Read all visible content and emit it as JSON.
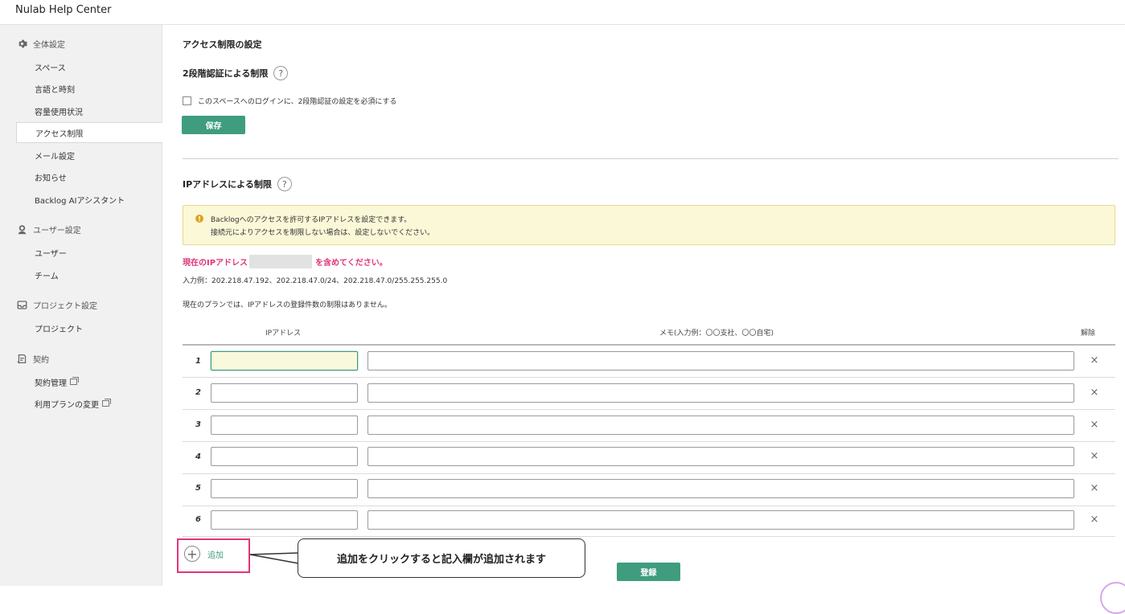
{
  "header": {
    "brand": "Nulab Help Center"
  },
  "sidebar": {
    "sections": [
      {
        "icon": "gear-icon",
        "label": "全体設定",
        "items": [
          {
            "label": "スペース"
          },
          {
            "label": "言語と時刻"
          },
          {
            "label": "容量使用状況"
          },
          {
            "label": "アクセス制限",
            "active": true
          },
          {
            "label": "メール設定"
          },
          {
            "label": "お知らせ"
          },
          {
            "label": "Backlog AIアシスタント"
          }
        ]
      },
      {
        "icon": "user-icon",
        "label": "ユーザー設定",
        "items": [
          {
            "label": "ユーザー"
          },
          {
            "label": "チーム"
          }
        ]
      },
      {
        "icon": "inbox-icon",
        "label": "プロジェクト設定",
        "items": [
          {
            "label": "プロジェクト"
          }
        ]
      },
      {
        "icon": "contract-icon",
        "label": "契約",
        "items": [
          {
            "label": "契約管理",
            "external": true
          },
          {
            "label": "利用プランの変更",
            "external": true
          }
        ]
      }
    ]
  },
  "main": {
    "title": "アクセス制限の設定",
    "twofa": {
      "heading": "2段階認証による制限",
      "help": "?",
      "checkbox_label": "このスペースへのログインに、2段階認証の設定を必須にする",
      "checked": false,
      "save_label": "保存"
    },
    "ip": {
      "heading": "IPアドレスによる制限",
      "help": "?",
      "notice_icon": "!",
      "notice_line1": "Backlogへのアクセスを許可するIPアドレスを設定できます。",
      "notice_line2": "接続元によりアクセスを制限しない場合は、設定しないでください。",
      "current_prefix": "現在のIPアドレス",
      "current_suffix": "を含めてください。",
      "example": "入力例：202.218.47.192、202.218.47.0/24、202.218.47.0/255.255.255.0",
      "plan_note": "現在のプランでは、IPアドレスの登録件数の制限はありません。",
      "columns": {
        "ip": "IPアドレス",
        "memo": "メモ(入力例：〇〇支社、〇〇自宅)",
        "remove": "解除"
      },
      "rows": [
        {
          "num": "1",
          "ip": "",
          "memo": ""
        },
        {
          "num": "2",
          "ip": "",
          "memo": ""
        },
        {
          "num": "3",
          "ip": "",
          "memo": ""
        },
        {
          "num": "4",
          "ip": "",
          "memo": ""
        },
        {
          "num": "5",
          "ip": "",
          "memo": ""
        },
        {
          "num": "6",
          "ip": "",
          "memo": ""
        }
      ],
      "remove_symbol": "×",
      "add_label": "追加",
      "add_symbol": "+",
      "submit_label": "登録"
    },
    "callout": "追加をクリックすると記入欄が追加されます"
  },
  "colors": {
    "accent": "#3f9c7f",
    "highlight": "#e0357a",
    "notice_bg": "#fbf8d8"
  }
}
